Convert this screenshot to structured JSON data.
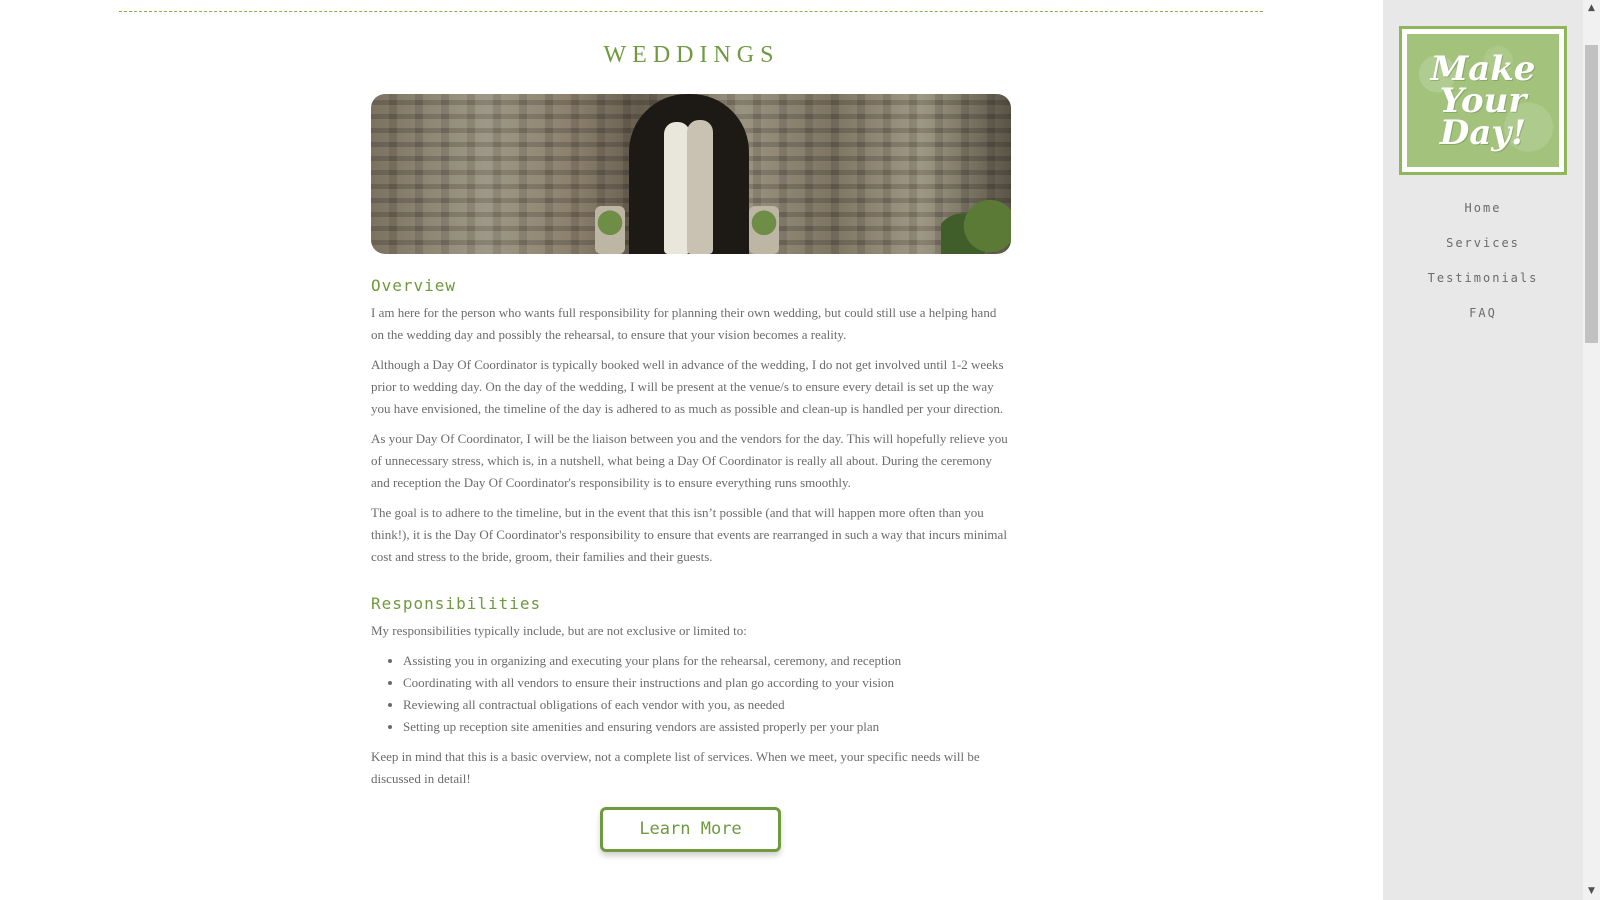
{
  "page": {
    "title": "WEDDINGS"
  },
  "hero": {
    "alt": "Bride and groom kissing in front of an arched wooden door in a stone wall"
  },
  "overview": {
    "heading": "Overview",
    "paragraphs": [
      "I am here for the person who wants full responsibility for planning their own wedding, but could still use a helping hand on the wedding day and possibly the rehearsal, to ensure that your vision becomes a reality.",
      "Although a Day Of Coordinator is typically booked well in advance of the wedding, I do not get involved until 1-2 weeks prior to wedding day. On the day of the wedding, I will be present at the venue/s to ensure every detail is set up the way you have envisioned, the timeline of the day is adhered to as much as possible and clean-up is handled per your direction.",
      "As your Day Of Coordinator, I will be the liaison between you and the vendors for the day. This will hopefully relieve you of unnecessary stress, which is, in a nutshell, what being a Day Of Coordinator is really all about. During the ceremony and reception the Day Of Coordinator's responsibility is to ensure everything runs smoothly.",
      "The goal is to adhere to the timeline, but in the event that this isn’t possible (and that will happen more often than you think!), it is the Day Of Coordinator's responsibility to ensure that events are rearranged in such a way that incurs minimal cost and stress to the bride, groom, their families and their guests."
    ]
  },
  "responsibilities": {
    "heading": "Responsibilities",
    "intro": "My responsibilities typically include, but are not exclusive or limited to:",
    "items": [
      "Assisting you in organizing and executing your plans for the rehearsal, ceremony, and reception",
      "Coordinating with all vendors to ensure their instructions and plan go according to your vision",
      "Reviewing all contractual obligations of each vendor with you, as needed",
      "Setting up reception site amenities and ensuring vendors are assisted properly per your plan"
    ],
    "closing": "Keep in mind that this is a basic overview, not a complete list of services. When we meet, your specific needs will be discussed in detail!"
  },
  "cta": {
    "label": "Learn More"
  },
  "sidebar": {
    "logo_lines": [
      "Make",
      "Your",
      "Day!"
    ],
    "nav": [
      {
        "label": "Home"
      },
      {
        "label": "Services"
      },
      {
        "label": "Testimonials"
      },
      {
        "label": "FAQ"
      }
    ]
  },
  "scrollbar": {
    "up_glyph": "▲",
    "down_glyph": "▼"
  },
  "colors": {
    "accent_green": "#6f9a3f",
    "logo_green": "#a3c37d",
    "logo_border": "#90b65a",
    "body_text": "#6b6b6b",
    "sidebar_bg": "#e8e8e8"
  }
}
